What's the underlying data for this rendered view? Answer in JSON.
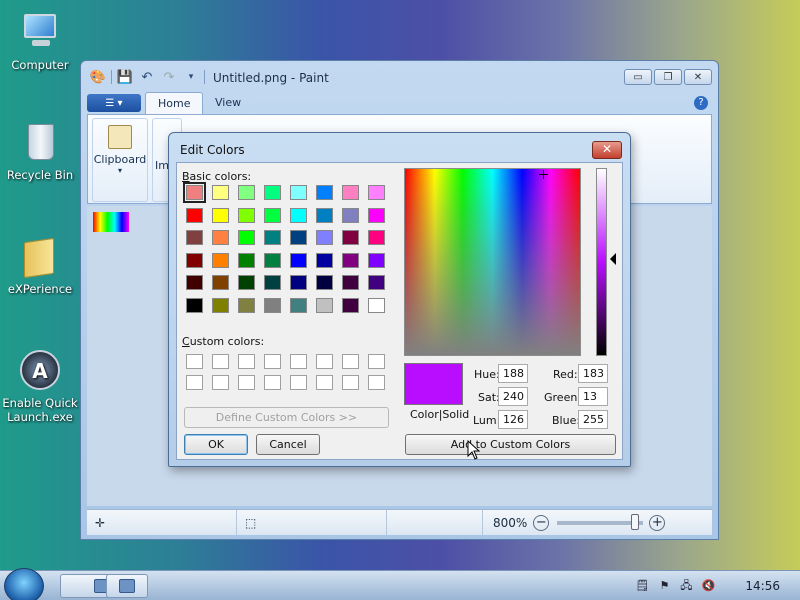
{
  "desktop": {
    "icons": [
      {
        "label": "Computer",
        "icon": "computer-icon"
      },
      {
        "label": "Recycle Bin",
        "icon": "recycle-bin-icon"
      },
      {
        "label": "eXPerience",
        "icon": "folder-icon"
      },
      {
        "label_line1": "Enable Quick",
        "label_line2": "Launch.exe",
        "icon": "launcher-icon"
      }
    ]
  },
  "paint": {
    "title": "Untitled.png - Paint",
    "tabs": [
      "Home",
      "View"
    ],
    "ribbon": {
      "clipboard_label": "Clipboard",
      "image_label_partial": "Im"
    },
    "status": {
      "zoom": "800%",
      "zoom_out": "−",
      "zoom_in": "+"
    },
    "window_buttons": {
      "minimize": "▭",
      "restore": "❐",
      "close": "✕"
    }
  },
  "dialog": {
    "title": "Edit Colors",
    "close_label": "✕",
    "basic_colors_label_b": "B",
    "basic_colors_label_rest": "asic colors:",
    "custom_colors_label_c": "C",
    "custom_colors_label_rest": "ustom colors:",
    "basic_colors": [
      "#f08080",
      "#ffff80",
      "#80ff80",
      "#00ff80",
      "#80ffff",
      "#0080ff",
      "#ff80c0",
      "#ff80ff",
      "#ff0000",
      "#ffff00",
      "#80ff00",
      "#00ff40",
      "#00ffff",
      "#0080c0",
      "#8080c0",
      "#ff00ff",
      "#804040",
      "#ff8040",
      "#00ff00",
      "#008080",
      "#004080",
      "#8080ff",
      "#800040",
      "#ff0080",
      "#800000",
      "#ff8000",
      "#008000",
      "#008040",
      "#0000ff",
      "#0000a0",
      "#800080",
      "#8000ff",
      "#400000",
      "#804000",
      "#004000",
      "#004040",
      "#000080",
      "#000040",
      "#400040",
      "#400080",
      "#000000",
      "#808000",
      "#808040",
      "#808080",
      "#408080",
      "#c0c0c0",
      "#400040",
      "#ffffff"
    ],
    "selected_index": 0,
    "define_custom_label": "Define Custom Colors >>",
    "ok_label": "OK",
    "cancel_label": "Cancel",
    "add_custom_label": "Add to Custom Colors",
    "color_solid_label": "Color|Solid",
    "fields": {
      "hue_label": "Hue:",
      "hue": "188",
      "sat_label": "Sat:",
      "sat": "240",
      "lum_label": "Lum:",
      "lum": "126",
      "red_label": "Red:",
      "red": "183",
      "green_label": "Green:",
      "green": "13",
      "blue_label": "Blue:",
      "blue": "255"
    },
    "preview_color": "#b90dff"
  },
  "taskbar": {
    "clock": "14:56"
  }
}
